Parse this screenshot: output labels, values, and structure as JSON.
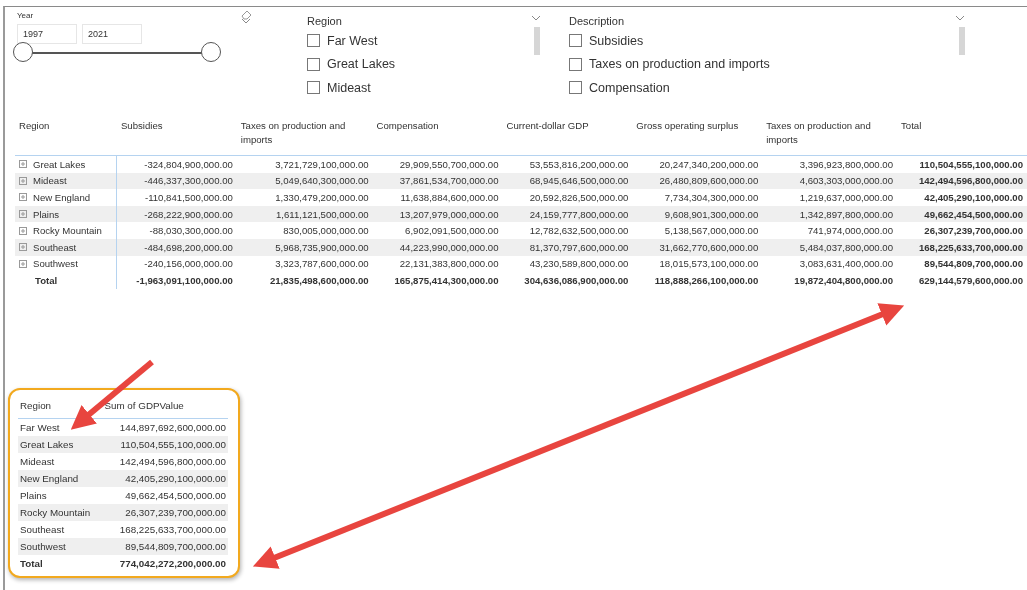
{
  "year_slicer": {
    "title": "Year",
    "start": "1997",
    "end": "2021",
    "level": 1
  },
  "region_slicer": {
    "title": "Region",
    "items": [
      {
        "label": "Far West",
        "checked": false
      },
      {
        "label": "Great Lakes",
        "checked": false
      },
      {
        "label": "Mideast",
        "checked": false
      }
    ]
  },
  "description_slicer": {
    "title": "Description",
    "items": [
      {
        "label": "Subsidies",
        "checked": false
      },
      {
        "label": "Taxes on production and imports",
        "checked": false
      },
      {
        "label": "Compensation",
        "checked": false
      }
    ]
  },
  "matrix": {
    "columns": [
      "Region",
      "Subsidies",
      "Taxes on production and imports",
      "Compensation",
      "Current-dollar GDP",
      "Gross operating surplus",
      "Taxes on production and imports",
      "Total"
    ],
    "rows": [
      {
        "region": "Great Lakes",
        "values": [
          "-324,804,900,000.00",
          "3,721,729,100,000.00",
          "29,909,550,700,000.00",
          "53,553,816,200,000.00",
          "20,247,340,200,000.00",
          "3,396,923,800,000.00",
          "110,504,555,100,000.00"
        ]
      },
      {
        "region": "Mideast",
        "values": [
          "-446,337,300,000.00",
          "5,049,640,300,000.00",
          "37,861,534,700,000.00",
          "68,945,646,500,000.00",
          "26,480,809,600,000.00",
          "4,603,303,000,000.00",
          "142,494,596,800,000.00"
        ]
      },
      {
        "region": "New England",
        "values": [
          "-110,841,500,000.00",
          "1,330,479,200,000.00",
          "11,638,884,600,000.00",
          "20,592,826,500,000.00",
          "7,734,304,300,000.00",
          "1,219,637,000,000.00",
          "42,405,290,100,000.00"
        ]
      },
      {
        "region": "Plains",
        "values": [
          "-268,222,900,000.00",
          "1,611,121,500,000.00",
          "13,207,979,000,000.00",
          "24,159,777,800,000.00",
          "9,608,901,300,000.00",
          "1,342,897,800,000.00",
          "49,662,454,500,000.00"
        ]
      },
      {
        "region": "Rocky Mountain",
        "values": [
          "-88,030,300,000.00",
          "830,005,000,000.00",
          "6,902,091,500,000.00",
          "12,782,632,500,000.00",
          "5,138,567,000,000.00",
          "741,974,000,000.00",
          "26,307,239,700,000.00"
        ]
      },
      {
        "region": "Southeast",
        "values": [
          "-484,698,200,000.00",
          "5,968,735,900,000.00",
          "44,223,990,000,000.00",
          "81,370,797,600,000.00",
          "31,662,770,600,000.00",
          "5,484,037,800,000.00",
          "168,225,633,700,000.00"
        ]
      },
      {
        "region": "Southwest",
        "values": [
          "-240,156,000,000.00",
          "3,323,787,600,000.00",
          "22,131,383,800,000.00",
          "43,230,589,800,000.00",
          "18,015,573,100,000.00",
          "3,083,631,400,000.00",
          "89,544,809,700,000.00"
        ]
      }
    ],
    "total": {
      "label": "Total",
      "values": [
        "-1,963,091,100,000.00",
        "21,835,498,600,000.00",
        "165,875,414,300,000.00",
        "304,636,086,900,000.00",
        "118,888,266,100,000.00",
        "19,872,404,800,000.00",
        "629,144,579,600,000.00"
      ]
    }
  },
  "summary_table": {
    "columns": [
      "Region",
      "Sum of GDPValue"
    ],
    "rows": [
      {
        "region": "Far West",
        "value": "144,897,692,600,000.00"
      },
      {
        "region": "Great Lakes",
        "value": "110,504,555,100,000.00"
      },
      {
        "region": "Mideast",
        "value": "142,494,596,800,000.00"
      },
      {
        "region": "New England",
        "value": "42,405,290,100,000.00"
      },
      {
        "region": "Plains",
        "value": "49,662,454,500,000.00"
      },
      {
        "region": "Rocky Mountain",
        "value": "26,307,239,700,000.00"
      },
      {
        "region": "Southeast",
        "value": "168,225,633,700,000.00"
      },
      {
        "region": "Southwest",
        "value": "89,544,809,700,000.00"
      }
    ],
    "total": {
      "label": "Total",
      "value": "774,042,272,200,000.00"
    }
  }
}
